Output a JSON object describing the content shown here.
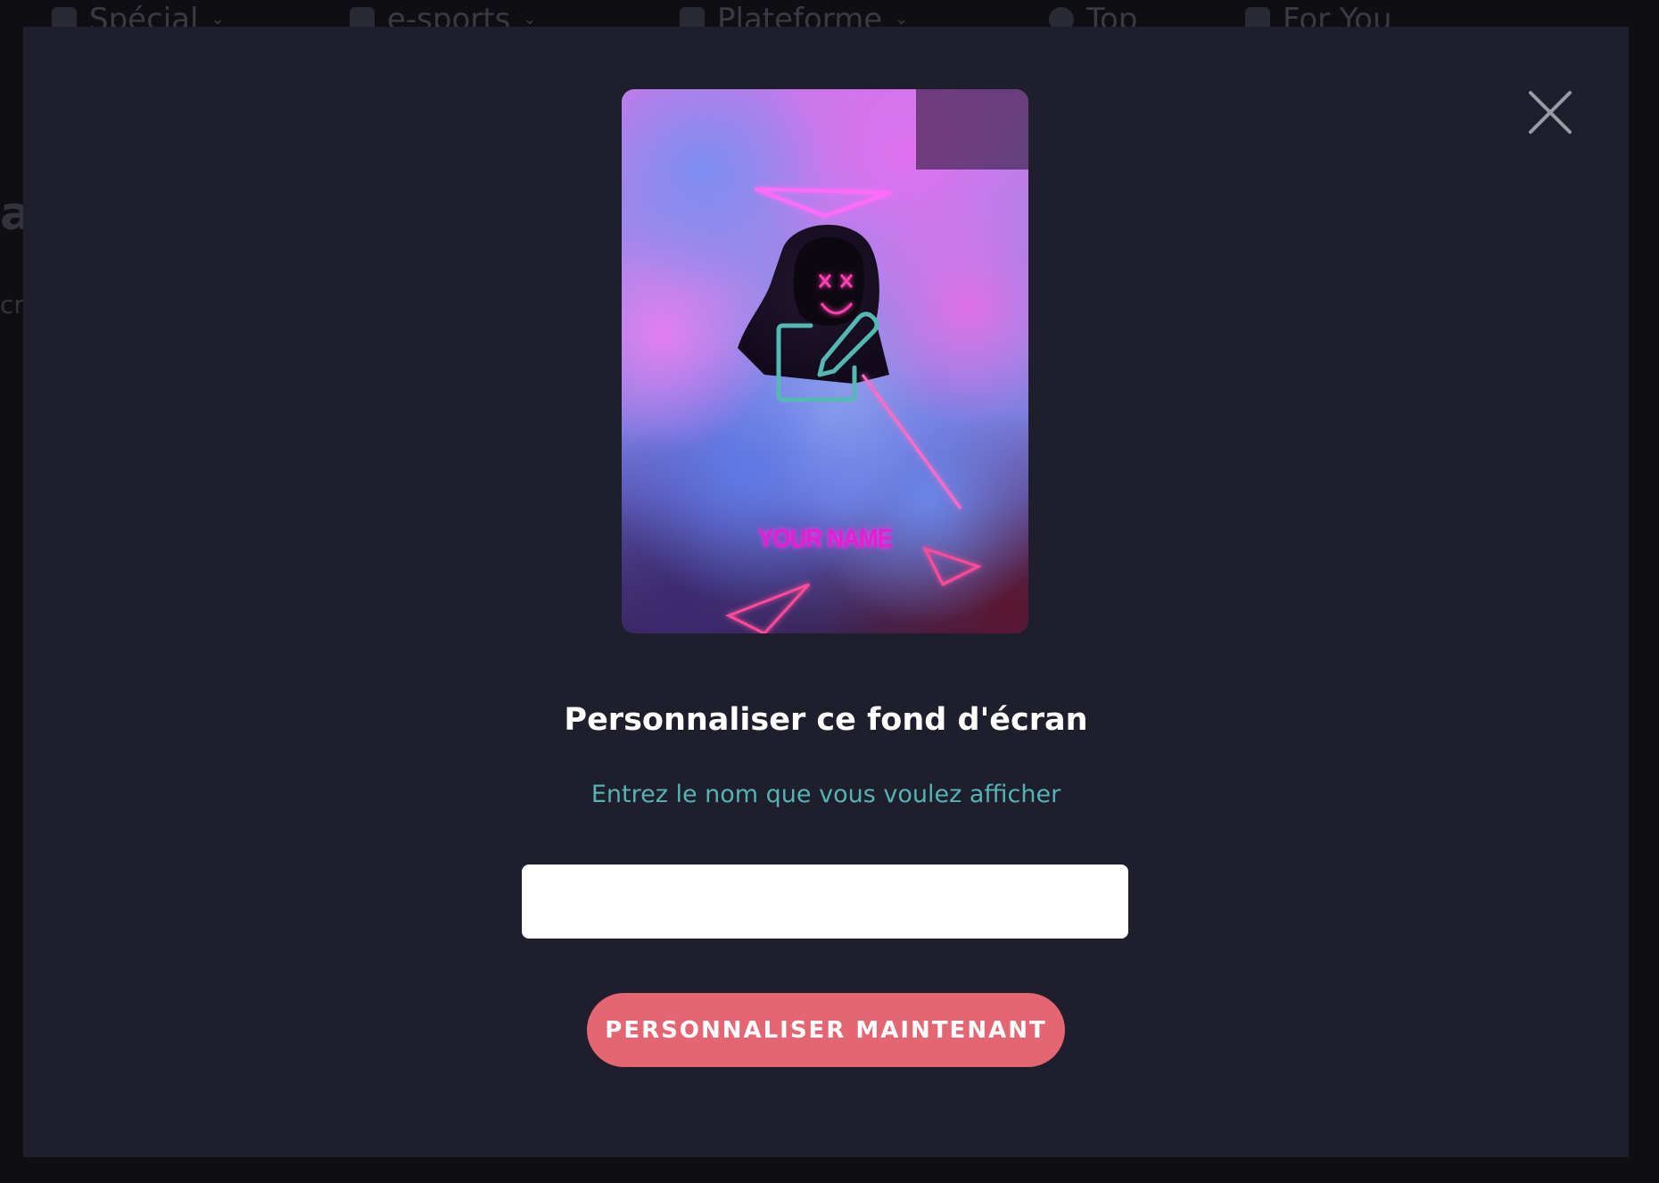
{
  "background": {
    "nav": [
      {
        "label": "Spécial",
        "icon": "sparkle-icon"
      },
      {
        "label": "e-sports",
        "icon": "controller-icon"
      },
      {
        "label": "Plateforme",
        "icon": "device-icon"
      },
      {
        "label": "Top",
        "icon": "trophy-icon"
      },
      {
        "label": "For You",
        "icon": "user-icon"
      }
    ],
    "left_heading_fragment": "a",
    "left_text_fragment": "cr"
  },
  "modal": {
    "close_icon": "close-icon",
    "preview": {
      "name_text": "YOUR NAME",
      "edit_icon": "edit-icon"
    },
    "title": "Personnaliser ce fond d'écran",
    "subtitle": "Entrez le nom que vous voulez afficher",
    "name_input": {
      "value": "",
      "placeholder": ""
    },
    "cta_label": "PERSONNALISER MAINTENANT"
  },
  "colors": {
    "modal_bg": "#1e1e2d",
    "accent_teal": "#56b3b4",
    "cta_bg": "#e46672",
    "page_bg": "#0f0f13"
  }
}
